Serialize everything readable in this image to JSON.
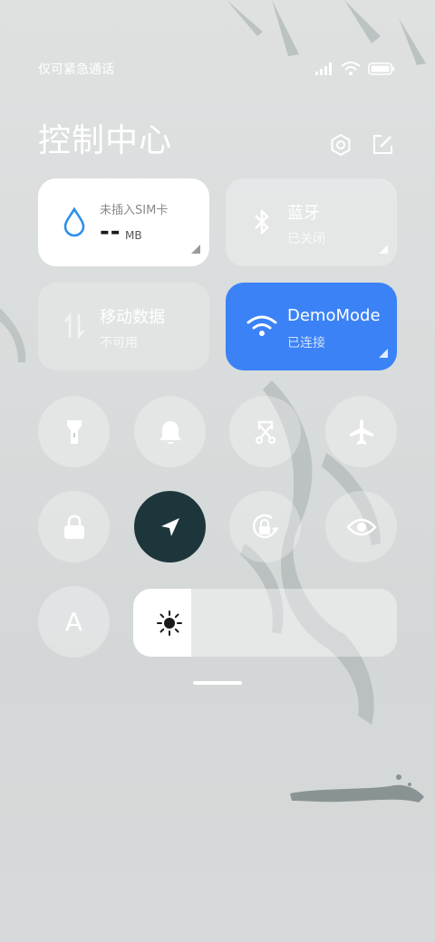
{
  "status_bar": {
    "carrier": "仅可紧急通话"
  },
  "header": {
    "title": "控制中心"
  },
  "tiles": {
    "data": {
      "label": "未插入SIM卡",
      "value": "--",
      "unit": "MB"
    },
    "bluetooth": {
      "label": "蓝牙",
      "status": "已关闭"
    },
    "mobile_data": {
      "label": "移动数据",
      "status": "不可用"
    },
    "wifi": {
      "label": "DemoMode",
      "status": "已连接"
    }
  },
  "toggles": [
    {
      "name": "flashlight",
      "icon": "flashlight-icon",
      "active": false
    },
    {
      "name": "ringer",
      "icon": "bell-icon",
      "active": false
    },
    {
      "name": "screenshot",
      "icon": "scissors-icon",
      "active": false
    },
    {
      "name": "airplane",
      "icon": "airplane-icon",
      "active": false
    },
    {
      "name": "lock-screen",
      "icon": "lock-icon",
      "active": false
    },
    {
      "name": "location",
      "icon": "location-arrow-icon",
      "active": true
    },
    {
      "name": "auto-rotate",
      "icon": "rotate-icon",
      "active": false
    },
    {
      "name": "reading-mode",
      "icon": "eye-icon",
      "active": false
    }
  ],
  "font_toggle": {
    "glyph": "A"
  },
  "brightness": {
    "level": 0.22
  },
  "colors": {
    "accent_blue": "#3b82f6",
    "active_toggle": "#1d363b"
  }
}
